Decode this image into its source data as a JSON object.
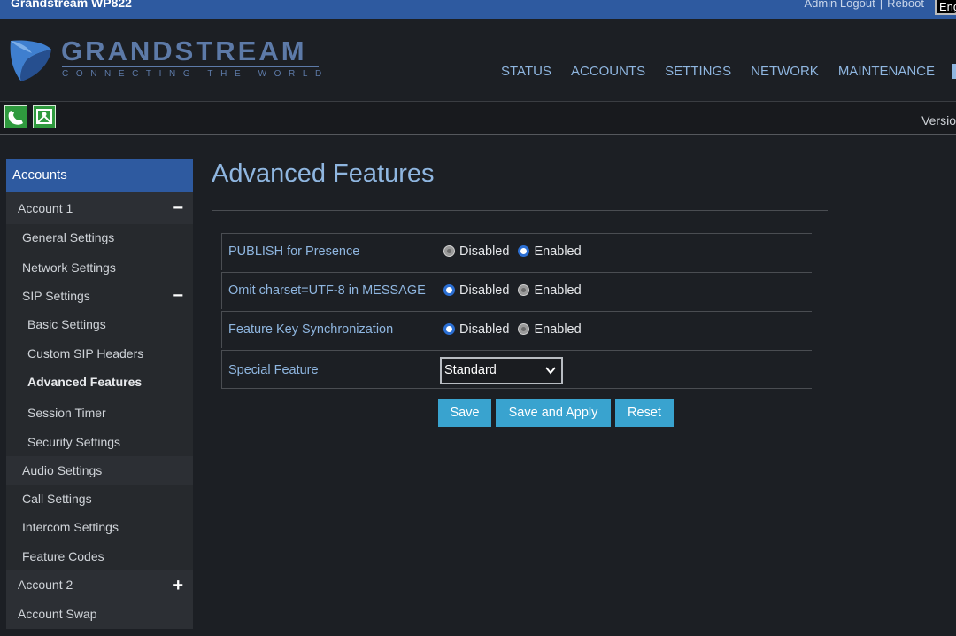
{
  "window": {
    "title": "Grandstream WP822"
  },
  "top_links": {
    "admin": "Admin",
    "logout": "Logout",
    "separator": "|",
    "reboot": "Reboot",
    "language": "Eng"
  },
  "brand": {
    "name": "GRANDSTREAM",
    "tagline": "CONNECTING THE WORLD",
    "color": "#5d7aa8"
  },
  "main_nav": [
    "STATUS",
    "ACCOUNTS",
    "SETTINGS",
    "NETWORK",
    "MAINTENANCE"
  ],
  "toolbar": {
    "icons": [
      "phone-icon",
      "message-icon"
    ],
    "version_label": "Versio"
  },
  "sidebar": {
    "header": "Accounts",
    "items": [
      {
        "label": "Account 1",
        "toggle": "−"
      },
      {
        "label": "General Settings"
      },
      {
        "label": "Network Settings"
      },
      {
        "label": "SIP Settings",
        "toggle": "−"
      },
      {
        "label": "Basic Settings"
      },
      {
        "label": "Custom SIP Headers"
      },
      {
        "label": "Advanced Features",
        "active": true
      },
      {
        "label": "Session Timer"
      },
      {
        "label": "Security Settings"
      },
      {
        "label": "Audio Settings"
      },
      {
        "label": "Call Settings"
      },
      {
        "label": "Intercom Settings"
      },
      {
        "label": "Feature Codes"
      },
      {
        "label": "Account 2",
        "toggle": "+"
      },
      {
        "label": "Account Swap"
      }
    ]
  },
  "page": {
    "title": "Advanced Features"
  },
  "form": {
    "rows": [
      {
        "label": "PUBLISH for Presence",
        "opt1": "Disabled",
        "opt2": "Enabled",
        "selected": "Enabled"
      },
      {
        "label": "Omit charset=UTF-8 in MESSAGE",
        "opt1": "Disabled",
        "opt2": "Enabled",
        "selected": "Disabled"
      },
      {
        "label": "Feature Key Synchronization",
        "opt1": "Disabled",
        "opt2": "Enabled",
        "selected": "Disabled"
      }
    ],
    "special_feature": {
      "label": "Special Feature",
      "value": "Standard"
    }
  },
  "buttons": {
    "save": "Save",
    "save_apply": "Save and Apply",
    "reset": "Reset"
  },
  "colors": {
    "accent": "#2e5aa0",
    "link": "#8fb6e0",
    "button": "#39a3cf",
    "background": "#1c1f24"
  }
}
